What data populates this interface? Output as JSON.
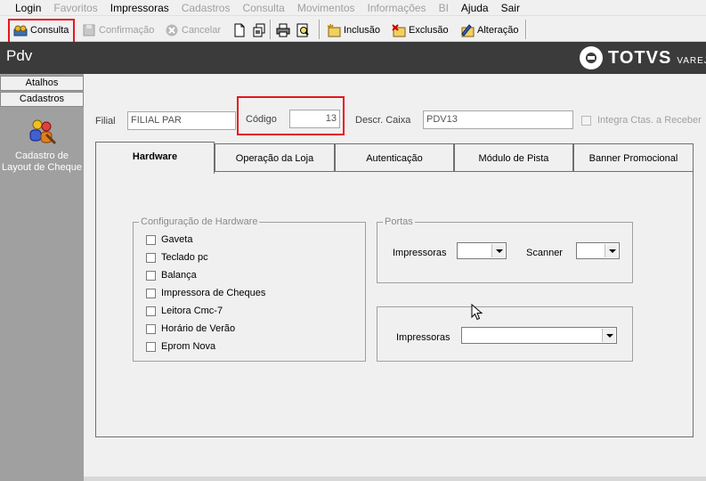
{
  "menu": [
    {
      "label": "Login",
      "enabled": true
    },
    {
      "label": "Favoritos",
      "enabled": false
    },
    {
      "label": "Impressoras",
      "enabled": true
    },
    {
      "label": "Cadastros",
      "enabled": false
    },
    {
      "label": "Consulta",
      "enabled": false
    },
    {
      "label": "Movimentos",
      "enabled": false
    },
    {
      "label": "Informações",
      "enabled": false
    },
    {
      "label": "BI",
      "enabled": false
    },
    {
      "label": "Ajuda",
      "enabled": true
    },
    {
      "label": "Sair",
      "enabled": true
    }
  ],
  "toolbar": {
    "consulta": "Consulta",
    "confirmacao": "Confirmação",
    "cancelar": "Cancelar",
    "inclusao": "Inclusão",
    "exclusao": "Exclusão",
    "alteracao": "Alteração"
  },
  "header": {
    "title": "Pdv",
    "brand": "TOTVS",
    "brand_sub": "VAREJO"
  },
  "leftnav": {
    "tab_atalhos": "Atalhos",
    "tab_cadastros": "Cadastros",
    "item_label": "Cadastro de Layout de Cheque"
  },
  "form": {
    "filial_label": "Filial",
    "filial_value": "FILIAL PAR",
    "codigo_label": "Código",
    "codigo_value": "13",
    "descr_label": "Descr. Caixa",
    "descr_value": "PDV13",
    "integra_label": "Integra Ctas. a Receber"
  },
  "tabs": [
    {
      "label": "Hardware",
      "active": true
    },
    {
      "label": "Operação da Loja",
      "active": false
    },
    {
      "label": "Autenticação",
      "active": false
    },
    {
      "label": "Módulo de Pista",
      "active": false
    },
    {
      "label": "Banner Promocional",
      "active": false
    }
  ],
  "hardware_group": {
    "title": "Configuração de Hardware",
    "items": [
      "Gaveta",
      "Teclado pc",
      "Balança",
      "Impressora de Cheques",
      "Leitora Cmc-7",
      "Horário de Verão",
      "Eprom Nova"
    ]
  },
  "portas_group": {
    "title": "Portas",
    "impressoras_label": "Impressoras",
    "scanner_label": "Scanner"
  },
  "printer_group": {
    "impressoras_label": "Impressoras"
  }
}
